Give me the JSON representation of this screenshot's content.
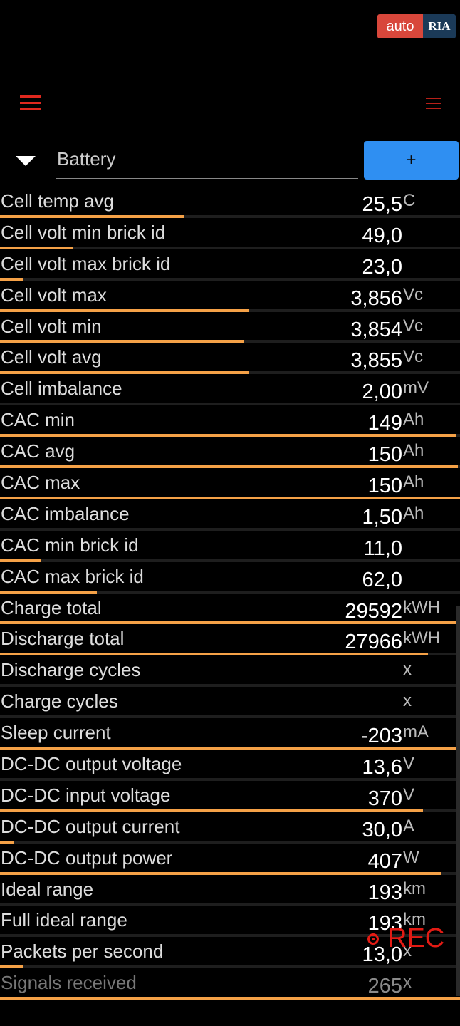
{
  "watermark": {
    "part1": "auto",
    "part2": "RIA"
  },
  "selector": {
    "label": "Battery",
    "add_label": "+"
  },
  "colors": {
    "accent_bar": "#f5a147",
    "button": "#2f8ff2",
    "menu": "#e0281e",
    "rec": "#e31b14"
  },
  "rows": [
    {
      "label": "Cell temp avg",
      "value": "25,5",
      "unit": "C",
      "fill": 0.4
    },
    {
      "label": "Cell volt min brick id",
      "value": "49,0",
      "unit": "",
      "fill": 0.16
    },
    {
      "label": "Cell volt max brick id",
      "value": "23,0",
      "unit": "",
      "fill": 0.05
    },
    {
      "label": "Cell volt max",
      "value": "3,856",
      "unit": "Vc",
      "fill": 0.54
    },
    {
      "label": "Cell volt min",
      "value": "3,854",
      "unit": "Vc",
      "fill": 0.53
    },
    {
      "label": "Cell volt avg",
      "value": "3,855",
      "unit": "Vc",
      "fill": 0.54
    },
    {
      "label": "Cell imbalance",
      "value": "2,00",
      "unit": "mV",
      "fill": 0
    },
    {
      "label": "CAC min",
      "value": "149",
      "unit": "Ah",
      "fill": 0.99
    },
    {
      "label": "CAC avg",
      "value": "150",
      "unit": "Ah",
      "fill": 0.995
    },
    {
      "label": "CAC max",
      "value": "150",
      "unit": "Ah",
      "fill": 1.0
    },
    {
      "label": "CAC imbalance",
      "value": "1,50",
      "unit": "Ah",
      "fill": 0
    },
    {
      "label": "CAC min brick id",
      "value": "11,0",
      "unit": "",
      "fill": 0.09
    },
    {
      "label": "CAC max brick id",
      "value": "62,0",
      "unit": "",
      "fill": 0.21
    },
    {
      "label": "Charge total",
      "value": "29592",
      "unit": "kWH",
      "fill": 1.0
    },
    {
      "label": "Discharge total",
      "value": "27966",
      "unit": "kWH",
      "fill": 0.93
    },
    {
      "label": "Discharge cycles",
      "value": "",
      "unit": "x",
      "fill": 0
    },
    {
      "label": "Charge cycles",
      "value": "",
      "unit": "x",
      "fill": 0
    },
    {
      "label": "Sleep current",
      "value": "-203",
      "unit": "mA",
      "fill": 1.0
    },
    {
      "label": "DC-DC output voltage",
      "value": "13,6",
      "unit": "V",
      "fill": 0
    },
    {
      "label": "DC-DC input voltage",
      "value": "370",
      "unit": "V",
      "fill": 0.92
    },
    {
      "label": "DC-DC output current",
      "value": "30,0",
      "unit": "A",
      "fill": 0.03
    },
    {
      "label": "DC-DC output power",
      "value": "407",
      "unit": "W",
      "fill": 0.96
    },
    {
      "label": "Ideal range",
      "value": "193",
      "unit": "km",
      "fill": 0
    },
    {
      "label": "Full ideal range",
      "value": "193",
      "unit": "km",
      "fill": 0
    },
    {
      "label": "Packets per second",
      "value": "13,0",
      "unit": "x",
      "fill": 0.05
    },
    {
      "label": "Signals received",
      "value": "265",
      "unit": "x",
      "fill": 1.0,
      "dim": true
    }
  ],
  "recording": {
    "label": "REC"
  }
}
